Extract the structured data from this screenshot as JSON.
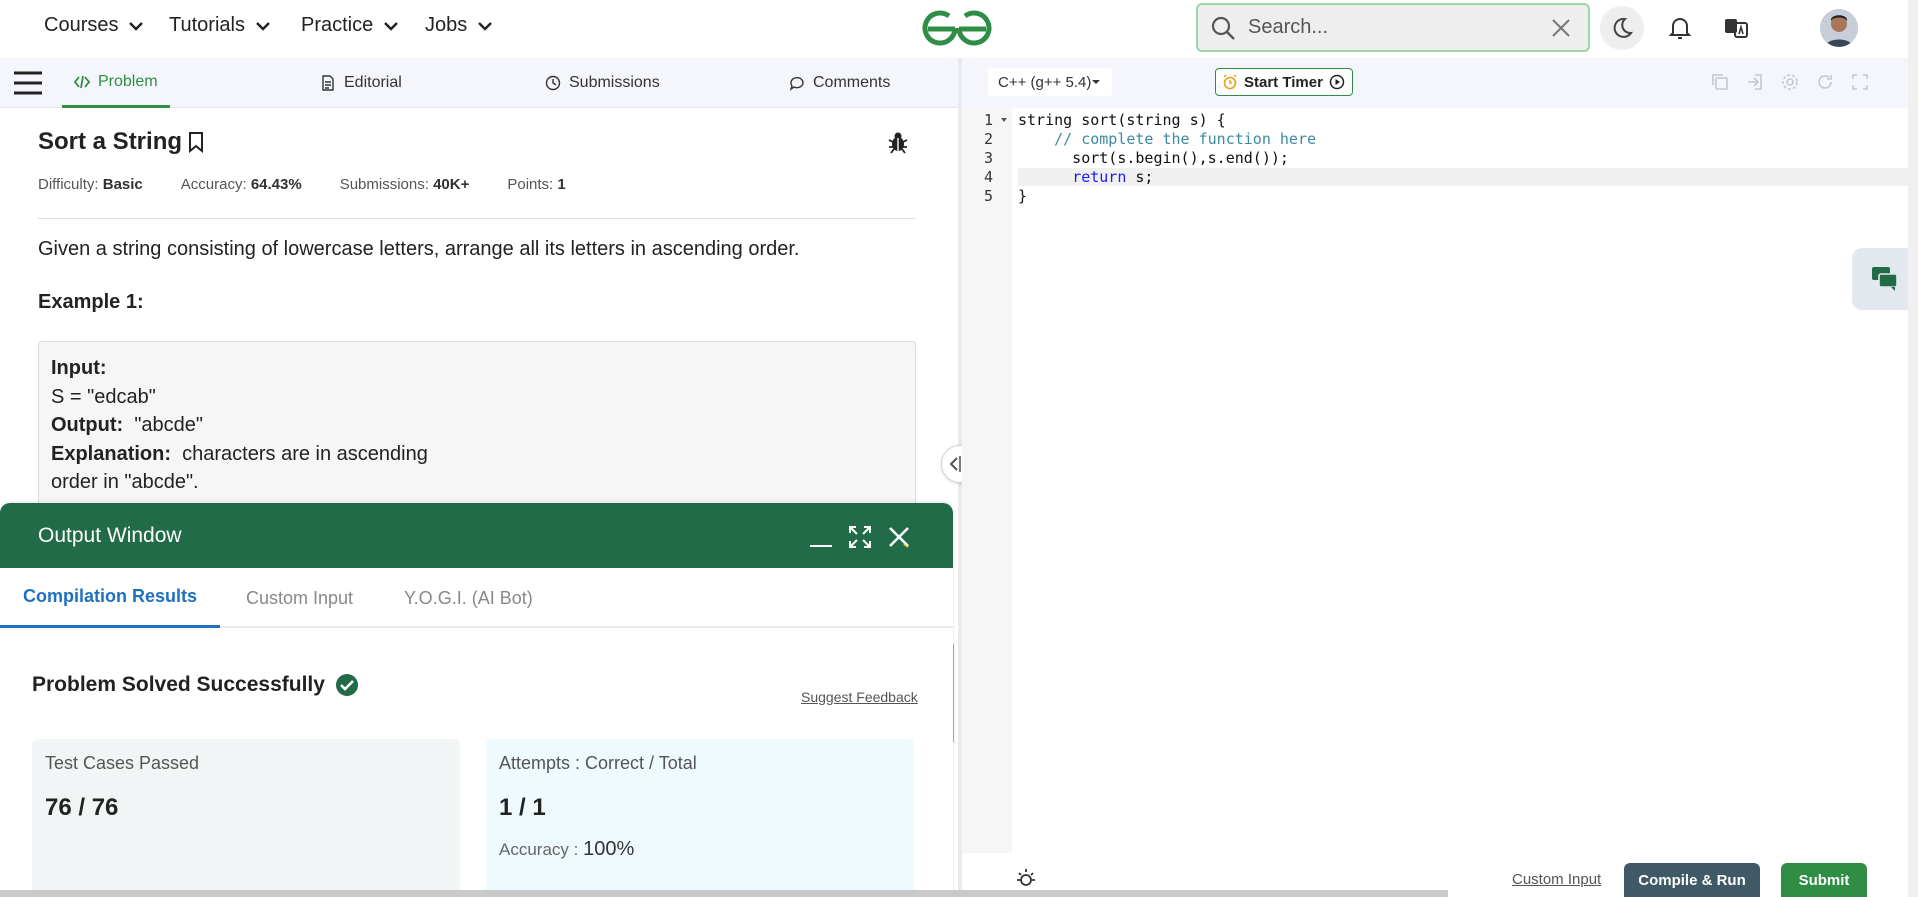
{
  "nav": {
    "items": [
      {
        "label": "Courses"
      },
      {
        "label": "Tutorials"
      },
      {
        "label": "Practice"
      },
      {
        "label": "Jobs"
      }
    ],
    "search_placeholder": "Search..."
  },
  "tabs": {
    "problem": "Problem",
    "editorial": "Editorial",
    "submissions": "Submissions",
    "comments": "Comments"
  },
  "problem": {
    "title": "Sort a String",
    "difficulty_label": "Difficulty:",
    "difficulty": "Basic",
    "accuracy_label": "Accuracy:",
    "accuracy": "64.43%",
    "submissions_label": "Submissions:",
    "submissions": "40K+",
    "points_label": "Points:",
    "points": "1",
    "description": "Given a string consisting of lowercase letters, arrange all its letters in ascending order.",
    "example_title": "Example 1:",
    "example": {
      "input_label": "Input:",
      "input_value": "S = \"edcab\"",
      "output_label": "Output:",
      "output_value": "\"abcde\"",
      "explanation_label": "Explanation:",
      "explanation_line1": "characters are in ascending",
      "explanation_line2": "order in \"abcde\"."
    }
  },
  "output_window": {
    "title": "Output Window",
    "tabs": [
      "Compilation Results",
      "Custom Input",
      "Y.O.G.I. (AI Bot)"
    ],
    "status": "Problem Solved Successfully",
    "feedback_link": "Suggest Feedback",
    "test_cases_label": "Test Cases Passed",
    "test_cases_value": "76 / 76",
    "attempts_label": "Attempts : Correct / Total",
    "attempts_value": "1 / 1",
    "accuracy_label": "Accuracy :",
    "accuracy_value": "100%"
  },
  "editor": {
    "language": "C++ (g++ 5.4)",
    "timer_label": "Start Timer",
    "line_numbers": [
      "1",
      "2",
      "3",
      "4",
      "5"
    ],
    "code": {
      "l1": "string sort(string s) {",
      "l2": "    // complete the function here",
      "l3_pre": "      sort(s.begin(),s.end());",
      "l4_kw": "return",
      "l4_rest": " s;",
      "l5": "}"
    },
    "custom_input_link": "Custom Input",
    "compile_label": "Compile & Run",
    "submit_label": "Submit"
  },
  "colors": {
    "brand_green": "#2f8d46",
    "output_header": "#216b49",
    "active_blue": "#1f70c1",
    "card_left_bg": "#f2f5f5",
    "card_right_bg": "#eefafe"
  }
}
